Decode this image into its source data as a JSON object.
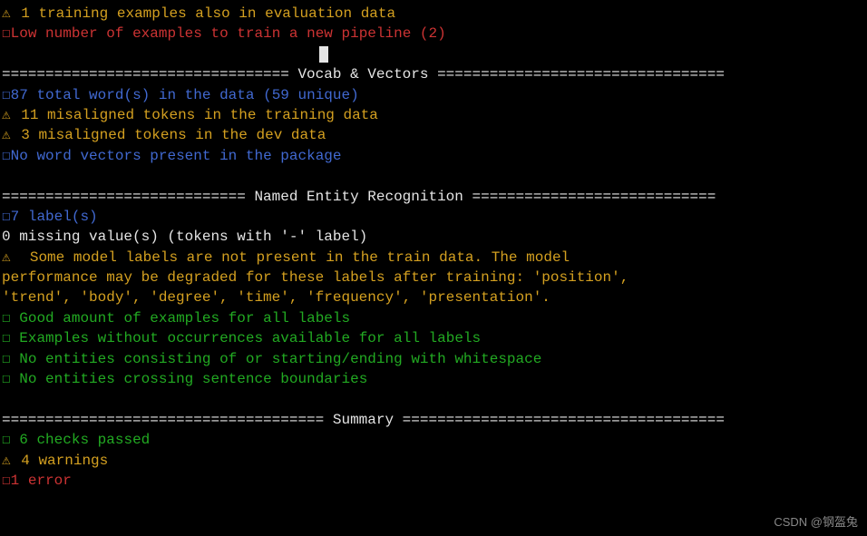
{
  "top": {
    "warn1": " 1 training examples also in evaluation data",
    "err1": "Low number of examples to train a new pipeline (2)"
  },
  "sections": {
    "vocab": {
      "header": "================================= Vocab & Vectors =================================",
      "info1": "87 total word(s) in the data (59 unique)",
      "warn1": " 11 misaligned tokens in the training data",
      "warn2": " 3 misaligned tokens in the dev data",
      "info2": "No word vectors present in the package"
    },
    "ner": {
      "header": "============================ Named Entity Recognition ============================",
      "info1": "7 label(s)",
      "plain1": "0 missing value(s) (tokens with '-' label)",
      "warn1a": "  Some model labels are not present in the train data. The model",
      "warn1b": "performance may be degraded for these labels after training: 'position',",
      "warn1c": "'trend', 'body', 'degree', 'time', 'frequency', 'presentation'.",
      "ok1": " Good amount of examples for all labels",
      "ok2": " Examples without occurrences available for all labels",
      "ok3": " No entities consisting of or starting/ending with whitespace",
      "ok4": " No entities crossing sentence boundaries"
    },
    "summary": {
      "header": "===================================== Summary =====================================",
      "ok": " 6 checks passed",
      "warn": " 4 warnings",
      "err": "1 error"
    }
  },
  "watermark": "CSDN @钢盔兔"
}
